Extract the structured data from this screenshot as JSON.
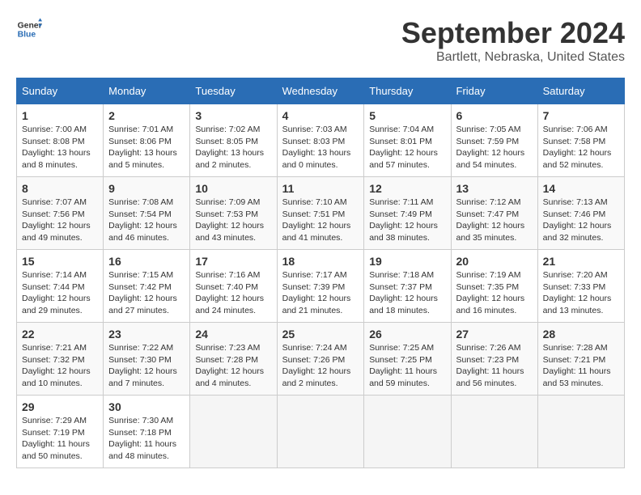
{
  "header": {
    "logo_line1": "General",
    "logo_line2": "Blue",
    "month_year": "September 2024",
    "location": "Bartlett, Nebraska, United States"
  },
  "weekdays": [
    "Sunday",
    "Monday",
    "Tuesday",
    "Wednesday",
    "Thursday",
    "Friday",
    "Saturday"
  ],
  "weeks": [
    [
      {
        "day": 1,
        "info": "Sunrise: 7:00 AM\nSunset: 8:08 PM\nDaylight: 13 hours\nand 8 minutes."
      },
      {
        "day": 2,
        "info": "Sunrise: 7:01 AM\nSunset: 8:06 PM\nDaylight: 13 hours\nand 5 minutes."
      },
      {
        "day": 3,
        "info": "Sunrise: 7:02 AM\nSunset: 8:05 PM\nDaylight: 13 hours\nand 2 minutes."
      },
      {
        "day": 4,
        "info": "Sunrise: 7:03 AM\nSunset: 8:03 PM\nDaylight: 13 hours\nand 0 minutes."
      },
      {
        "day": 5,
        "info": "Sunrise: 7:04 AM\nSunset: 8:01 PM\nDaylight: 12 hours\nand 57 minutes."
      },
      {
        "day": 6,
        "info": "Sunrise: 7:05 AM\nSunset: 7:59 PM\nDaylight: 12 hours\nand 54 minutes."
      },
      {
        "day": 7,
        "info": "Sunrise: 7:06 AM\nSunset: 7:58 PM\nDaylight: 12 hours\nand 52 minutes."
      }
    ],
    [
      {
        "day": 8,
        "info": "Sunrise: 7:07 AM\nSunset: 7:56 PM\nDaylight: 12 hours\nand 49 minutes."
      },
      {
        "day": 9,
        "info": "Sunrise: 7:08 AM\nSunset: 7:54 PM\nDaylight: 12 hours\nand 46 minutes."
      },
      {
        "day": 10,
        "info": "Sunrise: 7:09 AM\nSunset: 7:53 PM\nDaylight: 12 hours\nand 43 minutes."
      },
      {
        "day": 11,
        "info": "Sunrise: 7:10 AM\nSunset: 7:51 PM\nDaylight: 12 hours\nand 41 minutes."
      },
      {
        "day": 12,
        "info": "Sunrise: 7:11 AM\nSunset: 7:49 PM\nDaylight: 12 hours\nand 38 minutes."
      },
      {
        "day": 13,
        "info": "Sunrise: 7:12 AM\nSunset: 7:47 PM\nDaylight: 12 hours\nand 35 minutes."
      },
      {
        "day": 14,
        "info": "Sunrise: 7:13 AM\nSunset: 7:46 PM\nDaylight: 12 hours\nand 32 minutes."
      }
    ],
    [
      {
        "day": 15,
        "info": "Sunrise: 7:14 AM\nSunset: 7:44 PM\nDaylight: 12 hours\nand 29 minutes."
      },
      {
        "day": 16,
        "info": "Sunrise: 7:15 AM\nSunset: 7:42 PM\nDaylight: 12 hours\nand 27 minutes."
      },
      {
        "day": 17,
        "info": "Sunrise: 7:16 AM\nSunset: 7:40 PM\nDaylight: 12 hours\nand 24 minutes."
      },
      {
        "day": 18,
        "info": "Sunrise: 7:17 AM\nSunset: 7:39 PM\nDaylight: 12 hours\nand 21 minutes."
      },
      {
        "day": 19,
        "info": "Sunrise: 7:18 AM\nSunset: 7:37 PM\nDaylight: 12 hours\nand 18 minutes."
      },
      {
        "day": 20,
        "info": "Sunrise: 7:19 AM\nSunset: 7:35 PM\nDaylight: 12 hours\nand 16 minutes."
      },
      {
        "day": 21,
        "info": "Sunrise: 7:20 AM\nSunset: 7:33 PM\nDaylight: 12 hours\nand 13 minutes."
      }
    ],
    [
      {
        "day": 22,
        "info": "Sunrise: 7:21 AM\nSunset: 7:32 PM\nDaylight: 12 hours\nand 10 minutes."
      },
      {
        "day": 23,
        "info": "Sunrise: 7:22 AM\nSunset: 7:30 PM\nDaylight: 12 hours\nand 7 minutes."
      },
      {
        "day": 24,
        "info": "Sunrise: 7:23 AM\nSunset: 7:28 PM\nDaylight: 12 hours\nand 4 minutes."
      },
      {
        "day": 25,
        "info": "Sunrise: 7:24 AM\nSunset: 7:26 PM\nDaylight: 12 hours\nand 2 minutes."
      },
      {
        "day": 26,
        "info": "Sunrise: 7:25 AM\nSunset: 7:25 PM\nDaylight: 11 hours\nand 59 minutes."
      },
      {
        "day": 27,
        "info": "Sunrise: 7:26 AM\nSunset: 7:23 PM\nDaylight: 11 hours\nand 56 minutes."
      },
      {
        "day": 28,
        "info": "Sunrise: 7:28 AM\nSunset: 7:21 PM\nDaylight: 11 hours\nand 53 minutes."
      }
    ],
    [
      {
        "day": 29,
        "info": "Sunrise: 7:29 AM\nSunset: 7:19 PM\nDaylight: 11 hours\nand 50 minutes."
      },
      {
        "day": 30,
        "info": "Sunrise: 7:30 AM\nSunset: 7:18 PM\nDaylight: 11 hours\nand 48 minutes."
      },
      null,
      null,
      null,
      null,
      null
    ]
  ]
}
